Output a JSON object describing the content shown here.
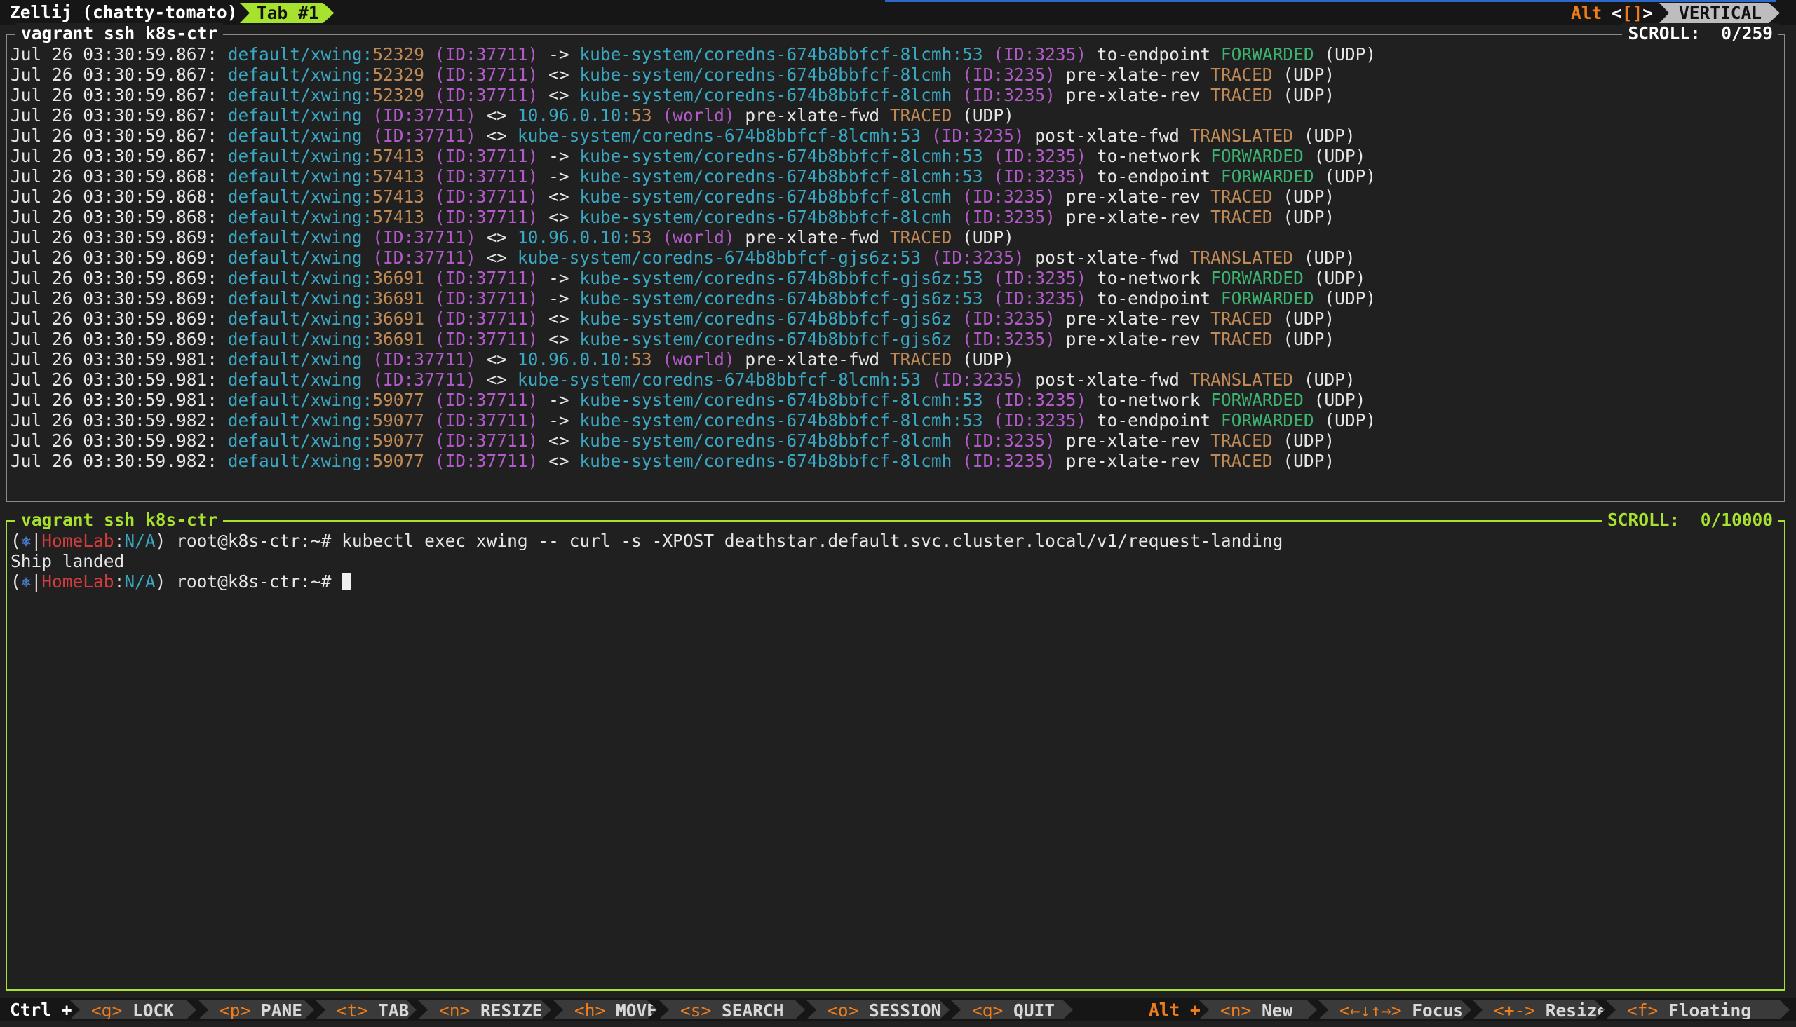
{
  "topbar": {
    "session_title": "Zellij (chatty-tomato)",
    "tab_label": "Tab #1",
    "mode_alt": "Alt",
    "mode_left_open": "<",
    "mode_brackets": "[]",
    "mode_right_close": ">",
    "layout_label": "VERTICAL"
  },
  "pane_top": {
    "title": "vagrant ssh k8s-ctr",
    "scroll": "SCROLL:  0/259",
    "lines": [
      [
        [
          "Jul 26 03:30:59.867: ",
          ""
        ],
        [
          "default/xwing:",
          "c"
        ],
        [
          "52329",
          "o"
        ],
        [
          " (ID:37711)",
          "p"
        ],
        [
          " -> ",
          ""
        ],
        [
          "kube-system/coredns-674b8bbfcf-8lcmh:53",
          "c"
        ],
        [
          " (ID:3235)",
          "p"
        ],
        [
          " to-endpoint ",
          ""
        ],
        [
          "FORWARDED",
          "g"
        ],
        [
          " (UDP)",
          ""
        ]
      ],
      [
        [
          "Jul 26 03:30:59.867: ",
          ""
        ],
        [
          "default/xwing:",
          "c"
        ],
        [
          "52329",
          "o"
        ],
        [
          " (ID:37711)",
          "p"
        ],
        [
          " <> ",
          ""
        ],
        [
          "kube-system/coredns-674b8bbfcf-8lcmh",
          "c"
        ],
        [
          " (ID:3235)",
          "p"
        ],
        [
          " pre-xlate-rev ",
          ""
        ],
        [
          "TRACED",
          "o"
        ],
        [
          " (UDP)",
          ""
        ]
      ],
      [
        [
          "Jul 26 03:30:59.867: ",
          ""
        ],
        [
          "default/xwing:",
          "c"
        ],
        [
          "52329",
          "o"
        ],
        [
          " (ID:37711)",
          "p"
        ],
        [
          " <> ",
          ""
        ],
        [
          "kube-system/coredns-674b8bbfcf-8lcmh",
          "c"
        ],
        [
          " (ID:3235)",
          "p"
        ],
        [
          " pre-xlate-rev ",
          ""
        ],
        [
          "TRACED",
          "o"
        ],
        [
          " (UDP)",
          ""
        ]
      ],
      [
        [
          "Jul 26 03:30:59.867: ",
          ""
        ],
        [
          "default/xwing",
          "c"
        ],
        [
          " (ID:37711)",
          "p"
        ],
        [
          " <> ",
          ""
        ],
        [
          "10.96.0.10:",
          "c"
        ],
        [
          "53",
          "o"
        ],
        [
          " (world)",
          "p"
        ],
        [
          " pre-xlate-fwd ",
          ""
        ],
        [
          "TRACED",
          "o"
        ],
        [
          " (UDP)",
          ""
        ]
      ],
      [
        [
          "Jul 26 03:30:59.867: ",
          ""
        ],
        [
          "default/xwing",
          "c"
        ],
        [
          " (ID:37711)",
          "p"
        ],
        [
          " <> ",
          ""
        ],
        [
          "kube-system/coredns-674b8bbfcf-8lcmh:53",
          "c"
        ],
        [
          " (ID:3235)",
          "p"
        ],
        [
          " post-xlate-fwd ",
          ""
        ],
        [
          "TRANSLATED",
          "o"
        ],
        [
          " (UDP)",
          ""
        ]
      ],
      [
        [
          "Jul 26 03:30:59.867: ",
          ""
        ],
        [
          "default/xwing:",
          "c"
        ],
        [
          "57413",
          "o"
        ],
        [
          " (ID:37711)",
          "p"
        ],
        [
          " -> ",
          ""
        ],
        [
          "kube-system/coredns-674b8bbfcf-8lcmh:53",
          "c"
        ],
        [
          " (ID:3235)",
          "p"
        ],
        [
          " to-network ",
          ""
        ],
        [
          "FORWARDED",
          "g"
        ],
        [
          " (UDP)",
          ""
        ]
      ],
      [
        [
          "Jul 26 03:30:59.868: ",
          ""
        ],
        [
          "default/xwing:",
          "c"
        ],
        [
          "57413",
          "o"
        ],
        [
          " (ID:37711)",
          "p"
        ],
        [
          " -> ",
          ""
        ],
        [
          "kube-system/coredns-674b8bbfcf-8lcmh:53",
          "c"
        ],
        [
          " (ID:3235)",
          "p"
        ],
        [
          " to-endpoint ",
          ""
        ],
        [
          "FORWARDED",
          "g"
        ],
        [
          " (UDP)",
          ""
        ]
      ],
      [
        [
          "Jul 26 03:30:59.868: ",
          ""
        ],
        [
          "default/xwing:",
          "c"
        ],
        [
          "57413",
          "o"
        ],
        [
          " (ID:37711)",
          "p"
        ],
        [
          " <> ",
          ""
        ],
        [
          "kube-system/coredns-674b8bbfcf-8lcmh",
          "c"
        ],
        [
          " (ID:3235)",
          "p"
        ],
        [
          " pre-xlate-rev ",
          ""
        ],
        [
          "TRACED",
          "o"
        ],
        [
          " (UDP)",
          ""
        ]
      ],
      [
        [
          "Jul 26 03:30:59.868: ",
          ""
        ],
        [
          "default/xwing:",
          "c"
        ],
        [
          "57413",
          "o"
        ],
        [
          " (ID:37711)",
          "p"
        ],
        [
          " <> ",
          ""
        ],
        [
          "kube-system/coredns-674b8bbfcf-8lcmh",
          "c"
        ],
        [
          " (ID:3235)",
          "p"
        ],
        [
          " pre-xlate-rev ",
          ""
        ],
        [
          "TRACED",
          "o"
        ],
        [
          " (UDP)",
          ""
        ]
      ],
      [
        [
          "Jul 26 03:30:59.869: ",
          ""
        ],
        [
          "default/xwing",
          "c"
        ],
        [
          " (ID:37711)",
          "p"
        ],
        [
          " <> ",
          ""
        ],
        [
          "10.96.0.10:",
          "c"
        ],
        [
          "53",
          "o"
        ],
        [
          " (world)",
          "p"
        ],
        [
          " pre-xlate-fwd ",
          ""
        ],
        [
          "TRACED",
          "o"
        ],
        [
          " (UDP)",
          ""
        ]
      ],
      [
        [
          "Jul 26 03:30:59.869: ",
          ""
        ],
        [
          "default/xwing",
          "c"
        ],
        [
          " (ID:37711)",
          "p"
        ],
        [
          " <> ",
          ""
        ],
        [
          "kube-system/coredns-674b8bbfcf-gjs6z:53",
          "c"
        ],
        [
          " (ID:3235)",
          "p"
        ],
        [
          " post-xlate-fwd ",
          ""
        ],
        [
          "TRANSLATED",
          "o"
        ],
        [
          " (UDP)",
          ""
        ]
      ],
      [
        [
          "Jul 26 03:30:59.869: ",
          ""
        ],
        [
          "default/xwing:",
          "c"
        ],
        [
          "36691",
          "o"
        ],
        [
          " (ID:37711)",
          "p"
        ],
        [
          " -> ",
          ""
        ],
        [
          "kube-system/coredns-674b8bbfcf-gjs6z:53",
          "c"
        ],
        [
          " (ID:3235)",
          "p"
        ],
        [
          " to-network ",
          ""
        ],
        [
          "FORWARDED",
          "g"
        ],
        [
          " (UDP)",
          ""
        ]
      ],
      [
        [
          "Jul 26 03:30:59.869: ",
          ""
        ],
        [
          "default/xwing:",
          "c"
        ],
        [
          "36691",
          "o"
        ],
        [
          " (ID:37711)",
          "p"
        ],
        [
          " -> ",
          ""
        ],
        [
          "kube-system/coredns-674b8bbfcf-gjs6z:53",
          "c"
        ],
        [
          " (ID:3235)",
          "p"
        ],
        [
          " to-endpoint ",
          ""
        ],
        [
          "FORWARDED",
          "g"
        ],
        [
          " (UDP)",
          ""
        ]
      ],
      [
        [
          "Jul 26 03:30:59.869: ",
          ""
        ],
        [
          "default/xwing:",
          "c"
        ],
        [
          "36691",
          "o"
        ],
        [
          " (ID:37711)",
          "p"
        ],
        [
          " <> ",
          ""
        ],
        [
          "kube-system/coredns-674b8bbfcf-gjs6z",
          "c"
        ],
        [
          " (ID:3235)",
          "p"
        ],
        [
          " pre-xlate-rev ",
          ""
        ],
        [
          "TRACED",
          "o"
        ],
        [
          " (UDP)",
          ""
        ]
      ],
      [
        [
          "Jul 26 03:30:59.869: ",
          ""
        ],
        [
          "default/xwing:",
          "c"
        ],
        [
          "36691",
          "o"
        ],
        [
          " (ID:37711)",
          "p"
        ],
        [
          " <> ",
          ""
        ],
        [
          "kube-system/coredns-674b8bbfcf-gjs6z",
          "c"
        ],
        [
          " (ID:3235)",
          "p"
        ],
        [
          " pre-xlate-rev ",
          ""
        ],
        [
          "TRACED",
          "o"
        ],
        [
          " (UDP)",
          ""
        ]
      ],
      [
        [
          "Jul 26 03:30:59.981: ",
          ""
        ],
        [
          "default/xwing",
          "c"
        ],
        [
          " (ID:37711)",
          "p"
        ],
        [
          " <> ",
          ""
        ],
        [
          "10.96.0.10:",
          "c"
        ],
        [
          "53",
          "o"
        ],
        [
          " (world)",
          "p"
        ],
        [
          " pre-xlate-fwd ",
          ""
        ],
        [
          "TRACED",
          "o"
        ],
        [
          " (UDP)",
          ""
        ]
      ],
      [
        [
          "Jul 26 03:30:59.981: ",
          ""
        ],
        [
          "default/xwing",
          "c"
        ],
        [
          " (ID:37711)",
          "p"
        ],
        [
          " <> ",
          ""
        ],
        [
          "kube-system/coredns-674b8bbfcf-8lcmh:53",
          "c"
        ],
        [
          " (ID:3235)",
          "p"
        ],
        [
          " post-xlate-fwd ",
          ""
        ],
        [
          "TRANSLATED",
          "o"
        ],
        [
          " (UDP)",
          ""
        ]
      ],
      [
        [
          "Jul 26 03:30:59.981: ",
          ""
        ],
        [
          "default/xwing:",
          "c"
        ],
        [
          "59077",
          "o"
        ],
        [
          " (ID:37711)",
          "p"
        ],
        [
          " -> ",
          ""
        ],
        [
          "kube-system/coredns-674b8bbfcf-8lcmh:53",
          "c"
        ],
        [
          " (ID:3235)",
          "p"
        ],
        [
          " to-network ",
          ""
        ],
        [
          "FORWARDED",
          "g"
        ],
        [
          " (UDP)",
          ""
        ]
      ],
      [
        [
          "Jul 26 03:30:59.982: ",
          ""
        ],
        [
          "default/xwing:",
          "c"
        ],
        [
          "59077",
          "o"
        ],
        [
          " (ID:37711)",
          "p"
        ],
        [
          " -> ",
          ""
        ],
        [
          "kube-system/coredns-674b8bbfcf-8lcmh:53",
          "c"
        ],
        [
          " (ID:3235)",
          "p"
        ],
        [
          " to-endpoint ",
          ""
        ],
        [
          "FORWARDED",
          "g"
        ],
        [
          " (UDP)",
          ""
        ]
      ],
      [
        [
          "Jul 26 03:30:59.982: ",
          ""
        ],
        [
          "default/xwing:",
          "c"
        ],
        [
          "59077",
          "o"
        ],
        [
          " (ID:37711)",
          "p"
        ],
        [
          " <> ",
          ""
        ],
        [
          "kube-system/coredns-674b8bbfcf-8lcmh",
          "c"
        ],
        [
          " (ID:3235)",
          "p"
        ],
        [
          " pre-xlate-rev ",
          ""
        ],
        [
          "TRACED",
          "o"
        ],
        [
          " (UDP)",
          ""
        ]
      ],
      [
        [
          "Jul 26 03:30:59.982: ",
          ""
        ],
        [
          "default/xwing:",
          "c"
        ],
        [
          "59077",
          "o"
        ],
        [
          " (ID:37711)",
          "p"
        ],
        [
          " <> ",
          ""
        ],
        [
          "kube-system/coredns-674b8bbfcf-8lcmh",
          "c"
        ],
        [
          " (ID:3235)",
          "p"
        ],
        [
          " pre-xlate-rev ",
          ""
        ],
        [
          "TRACED",
          "o"
        ],
        [
          " (UDP)",
          ""
        ]
      ]
    ]
  },
  "pane_bottom": {
    "title": "vagrant ssh k8s-ctr",
    "scroll": "SCROLL:  0/10000",
    "lines": [
      [
        [
          "(",
          ""
        ],
        [
          "⎈",
          "b"
        ],
        [
          "|",
          ""
        ],
        [
          "HomeLab",
          "r"
        ],
        [
          ":",
          ""
        ],
        [
          "N/A",
          "c"
        ],
        [
          ") root@k8s-ctr:~# kubectl exec xwing -- curl -s -XPOST deathstar.default.svc.cluster.local/v1/request-landing",
          ""
        ]
      ],
      [
        [
          "Ship landed",
          ""
        ]
      ],
      [
        [
          "(",
          ""
        ],
        [
          "⎈",
          "b"
        ],
        [
          "|",
          ""
        ],
        [
          "HomeLab",
          "r"
        ],
        [
          ":",
          ""
        ],
        [
          "N/A",
          "c"
        ],
        [
          ") root@k8s-ctr:~# ",
          ""
        ]
      ]
    ]
  },
  "statusbar": {
    "ctrl_label": "Ctrl +",
    "alt_label": "Alt +",
    "ctrl_hints": [
      {
        "key": "<g>",
        "label": "LOCK"
      },
      {
        "key": "<p>",
        "label": "PANE"
      },
      {
        "key": "<t>",
        "label": "TAB"
      },
      {
        "key": "<n>",
        "label": "RESIZE"
      },
      {
        "key": "<h>",
        "label": "MOVE"
      },
      {
        "key": "<s>",
        "label": "SEARCH"
      },
      {
        "key": "<o>",
        "label": "SESSION"
      },
      {
        "key": "<q>",
        "label": "QUIT"
      }
    ],
    "alt_hints": [
      {
        "key": "<n>",
        "label": "New"
      },
      {
        "key": "<←↓↑→>",
        "label": "Focus"
      },
      {
        "key": "<+->",
        "label": "Resize"
      },
      {
        "key": "<f>",
        "label": "Floating"
      }
    ]
  },
  "colors": {
    "cyan": "#3aa7c2",
    "purple": "#b35ac9",
    "orange": "#c08a57",
    "green": "#3cb371",
    "red": "#d23c3c",
    "active_pane": "#a6e22e",
    "mode_key": "#f07d1a"
  }
}
